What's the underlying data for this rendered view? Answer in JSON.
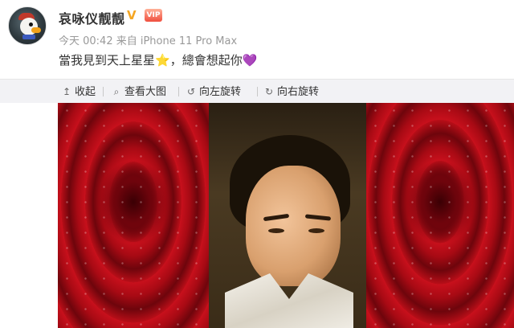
{
  "post": {
    "user_name": "哀咏仪靓靓",
    "verified_symbol": "V",
    "vip_label": "VIP",
    "meta": "今天 00:42 来自 iPhone 11 Pro Max",
    "text_main": "當我見到天上星星",
    "text_star": "⭐",
    "text_after": "，總會想起你",
    "text_heart": "💜"
  },
  "toolbar": {
    "collapse": {
      "icon": "↥",
      "label": "收起"
    },
    "view_large": {
      "icon": "⌕",
      "label": "查看大图"
    },
    "rotate_left": {
      "icon": "↺",
      "label": "向左旋转"
    },
    "rotate_right": {
      "icon": "↻",
      "label": "向右旋转"
    }
  },
  "colors": {
    "toolbar_bg": "#f2f2f5",
    "name_color": "#333333",
    "meta_color": "#999999",
    "verified": "#f5a623"
  },
  "icons": {
    "avatar": "duck-avatar-icon",
    "verified": "verified-v-icon",
    "vip": "vip-crown-icon"
  }
}
